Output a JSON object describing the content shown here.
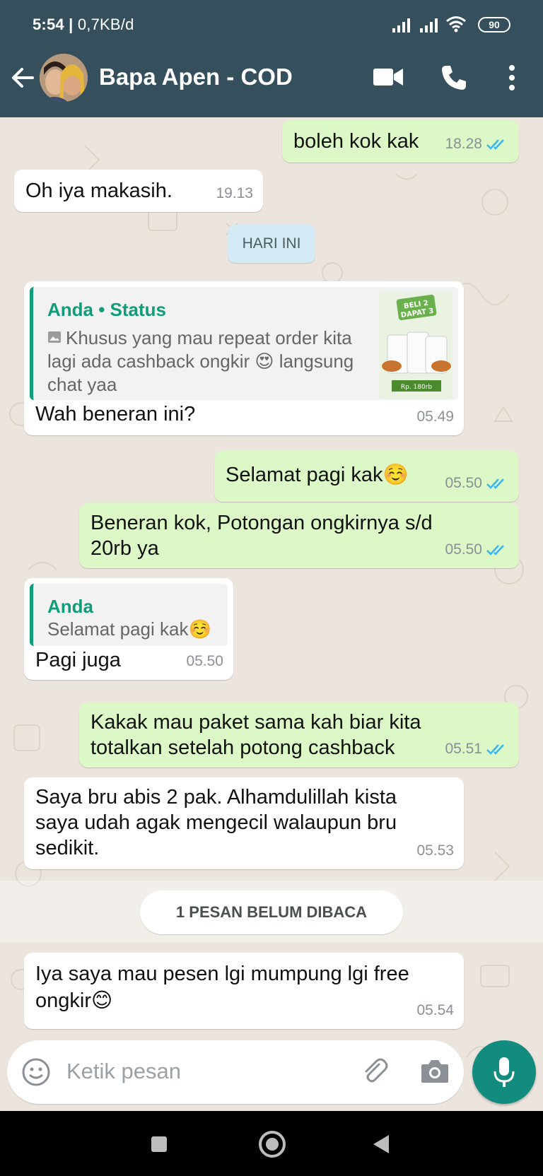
{
  "status_bar": {
    "time": "5:54",
    "network_speed": "0,7KB/d",
    "battery": "90"
  },
  "header": {
    "title": "Bapa Apen - COD"
  },
  "day_divider": "HARI INI",
  "messages": [
    {
      "direction": "out",
      "text": "boleh kok kak",
      "time": "18.28",
      "read": true
    },
    {
      "direction": "in",
      "text": "Oh iya makasih.",
      "time": "19.13"
    },
    {
      "direction": "in",
      "quote": {
        "author": "Anda • Status",
        "lines": [
          "Khusus yang mau repeat order kita",
          "lagi ada cashback ongkir 😍 langsung",
          "chat yaa"
        ],
        "thumb_text": [
          "BELI 2",
          "DAPAT 3",
          "Rp. 180rb"
        ]
      },
      "text": "Wah beneran ini?",
      "time": "05.49"
    },
    {
      "direction": "out",
      "text": "Selamat pagi kak☺️",
      "time": "05.50",
      "read": true
    },
    {
      "direction": "out",
      "lines": [
        "Beneran kok, Potongan ongkirnya s/d",
        "20rb ya"
      ],
      "time": "05.50",
      "read": true
    },
    {
      "direction": "in",
      "quote": {
        "author": "Anda",
        "lines": [
          "Selamat pagi kak☺️"
        ]
      },
      "text": "Pagi juga",
      "time": "05.50"
    },
    {
      "direction": "out",
      "lines": [
        "Kakak mau paket sama kah biar kita",
        "totalkan setelah potong cashback"
      ],
      "time": "05.51",
      "read": true
    },
    {
      "direction": "in",
      "lines": [
        "Saya bru abis 2 pak. Alhamdulillah kista",
        "saya udah agak mengecil walaupun bru",
        "sedikit."
      ],
      "time": "05.53"
    },
    {
      "direction": "in",
      "lines": [
        "Iya saya mau pesen lgi mumpung lgi free",
        "ongkir😊"
      ],
      "time": "05.54"
    }
  ],
  "unread_banner": "1 PESAN BELUM DIBACA",
  "composer": {
    "placeholder": "Ketik pesan"
  },
  "icons": [
    "back-arrow-icon",
    "video-call-icon",
    "phone-icon",
    "more-vert-icon",
    "emoji-icon",
    "attach-icon",
    "camera-icon",
    "mic-icon",
    "double-check-icon",
    "image-icon"
  ],
  "colors": {
    "header": "#35505c",
    "chat_background": "#ece5dd",
    "outgoing_bubble": "#dcf8c6",
    "incoming_bubble": "#ffffff",
    "accent": "#128c7e",
    "quote_accent": "#0f9d7a",
    "read_tick": "#34b7f1",
    "day_pill": "#d4eaf4"
  }
}
